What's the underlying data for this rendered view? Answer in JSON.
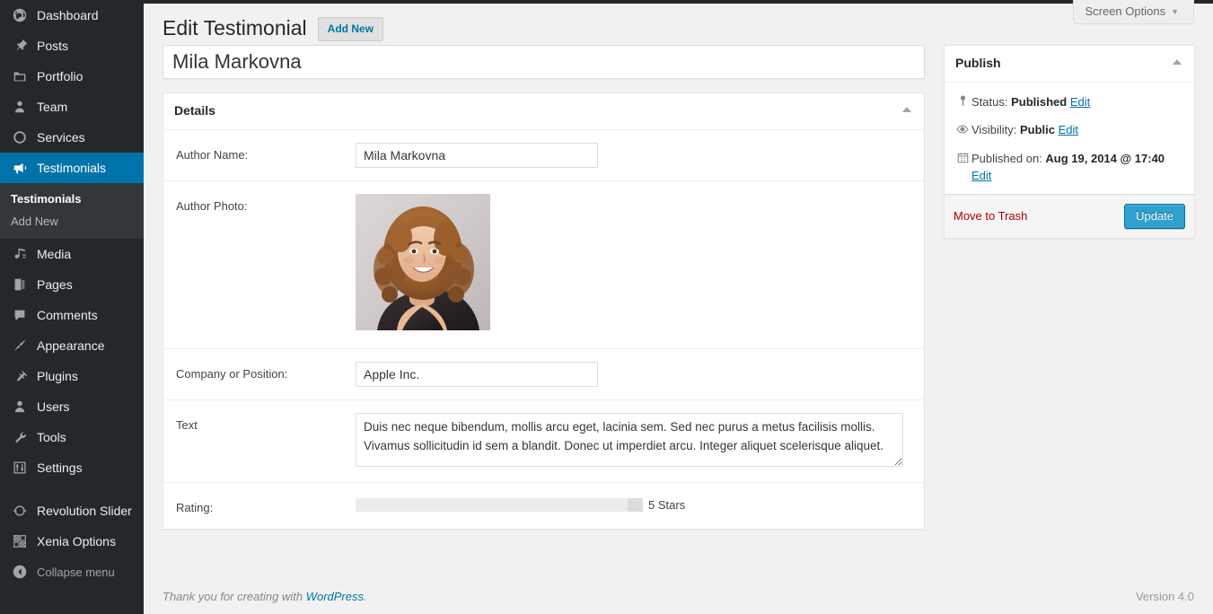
{
  "sidebar": {
    "items": [
      {
        "label": "Dashboard",
        "icon": "dashboard-icon",
        "current": false
      },
      {
        "label": "Posts",
        "icon": "pin-icon",
        "current": false
      },
      {
        "label": "Portfolio",
        "icon": "portfolio-icon",
        "current": false
      },
      {
        "label": "Team",
        "icon": "person-icon",
        "current": false
      },
      {
        "label": "Services",
        "icon": "circle-icon",
        "current": false
      },
      {
        "label": "Testimonials",
        "icon": "megaphone-icon",
        "current": true
      },
      {
        "label": "Media",
        "icon": "media-icon",
        "current": false
      },
      {
        "label": "Pages",
        "icon": "pages-icon",
        "current": false
      },
      {
        "label": "Comments",
        "icon": "comment-icon",
        "current": false
      },
      {
        "label": "Appearance",
        "icon": "brush-icon",
        "current": false
      },
      {
        "label": "Plugins",
        "icon": "plug-icon",
        "current": false
      },
      {
        "label": "Users",
        "icon": "users-icon",
        "current": false
      },
      {
        "label": "Tools",
        "icon": "wrench-icon",
        "current": false
      },
      {
        "label": "Settings",
        "icon": "sliders-icon",
        "current": false
      },
      {
        "label": "Revolution Slider",
        "icon": "revolution-icon",
        "current": false
      },
      {
        "label": "Xenia Options",
        "icon": "grid-icon",
        "current": false
      }
    ],
    "submenu": [
      {
        "label": "Testimonials",
        "current": true
      },
      {
        "label": "Add New",
        "current": false
      }
    ],
    "collapse_label": "Collapse menu",
    "collapse_icon": "collapse-arrow-icon",
    "accent_color": "#0073aa",
    "background_color": "#23282d",
    "submenu_background_color": "#32373c"
  },
  "screen_meta": {
    "screen_options_label": "Screen Options",
    "caret_icon": "chevron-down-icon"
  },
  "header": {
    "page_title": "Edit Testimonial",
    "add_new_label": "Add New"
  },
  "title_field": {
    "value": "Mila Markovna",
    "placeholder": "Enter title here"
  },
  "details_box": {
    "heading": "Details",
    "toggle_icon": "toggle-up-icon",
    "fields": {
      "author_name": {
        "label": "Author Name:",
        "value": "Mila Markovna"
      },
      "author_photo": {
        "label": "Author Photo:",
        "alt": "Portrait photo of Mila Markovna"
      },
      "company": {
        "label": "Company or Position:",
        "value": "Apple Inc."
      },
      "text": {
        "label": "Text",
        "value": "Duis nec neque bibendum, mollis arcu eget, lacinia sem. Sed nec purus a metus facilisis mollis. Vivamus sollicitudin id sem a blandit. Donec ut imperdiet arcu. Integer aliquet scelerisque aliquet."
      },
      "rating": {
        "label": "Rating:",
        "value_label": "5 Stars",
        "value": 5,
        "min": 1,
        "max": 5
      }
    }
  },
  "publish_box": {
    "heading": "Publish",
    "toggle_icon": "toggle-up-icon",
    "status": {
      "icon": "post-status-icon",
      "prefix": "Status: ",
      "value": "Published",
      "edit_label": "Edit"
    },
    "visibility": {
      "icon": "visibility-eye-icon",
      "prefix": "Visibility: ",
      "value": "Public",
      "edit_label": "Edit"
    },
    "published_on": {
      "icon": "calendar-icon",
      "prefix": "Published on: ",
      "value": "Aug 19, 2014 @ 17:40",
      "edit_label": "Edit"
    },
    "trash_label": "Move to Trash",
    "update_label": "Update",
    "primary_color": "#2ea2cc",
    "trash_color": "#a00"
  },
  "footer": {
    "thanks_prefix": "Thank you for creating with ",
    "wordpress_label": "WordPress",
    "thanks_suffix": ".",
    "version": "Version 4.0"
  }
}
